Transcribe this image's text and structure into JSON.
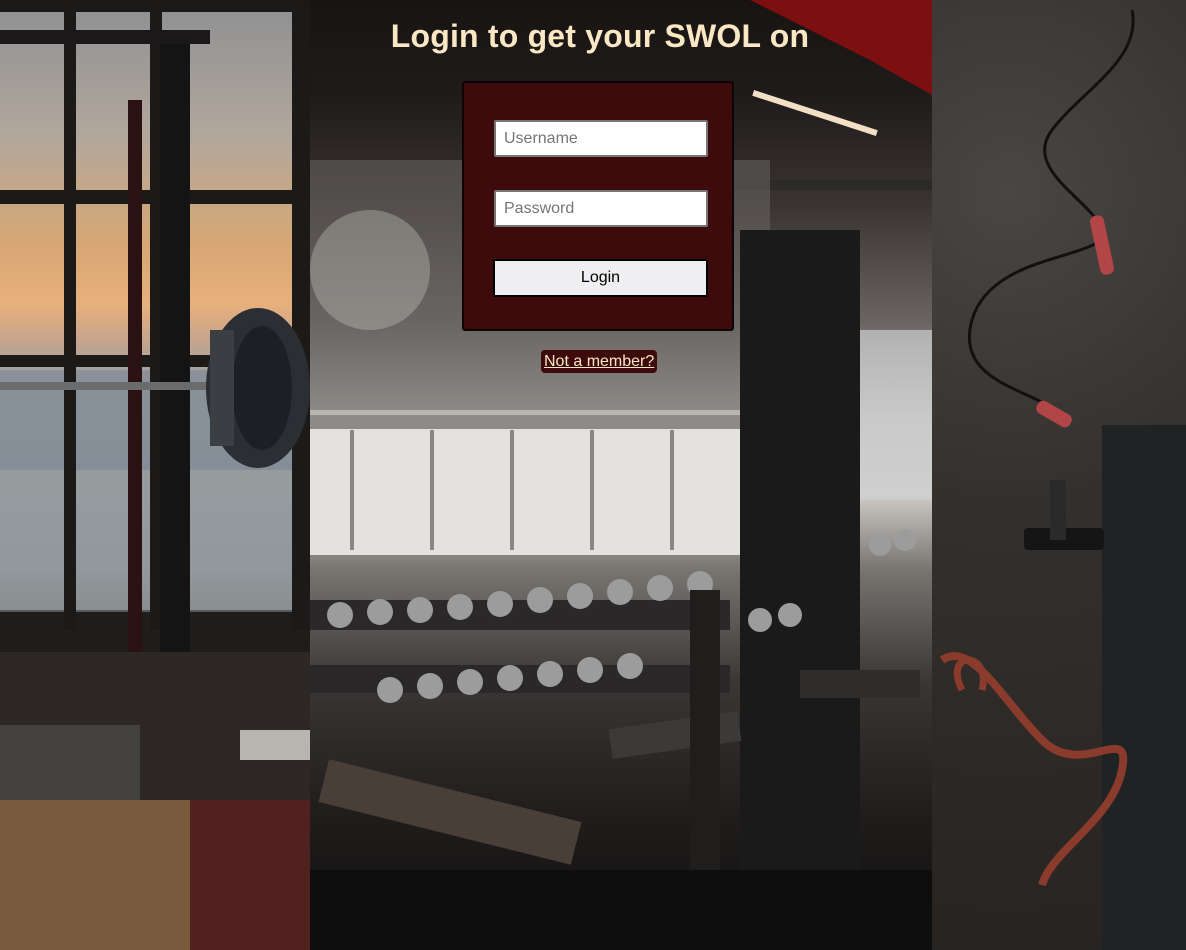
{
  "page": {
    "title": "Login to get your SWOL on"
  },
  "login_form": {
    "username_placeholder": "Username",
    "password_placeholder": "Password",
    "submit_label": "Login"
  },
  "signup_link": {
    "label": "Not a member?"
  },
  "background": {
    "left_photo": "gym-window-barbell-photo",
    "middle_photo": "gym-interior-dumbbell-rack-photo",
    "right_photo": "jump-rope-resistance-band-floor-photo"
  },
  "colors": {
    "title_text": "#fbe7c4",
    "card_background": "#3d0b0b",
    "link_background": "#3d0b0b",
    "link_text": "#fbe7c4",
    "button_background": "#efeff1"
  }
}
